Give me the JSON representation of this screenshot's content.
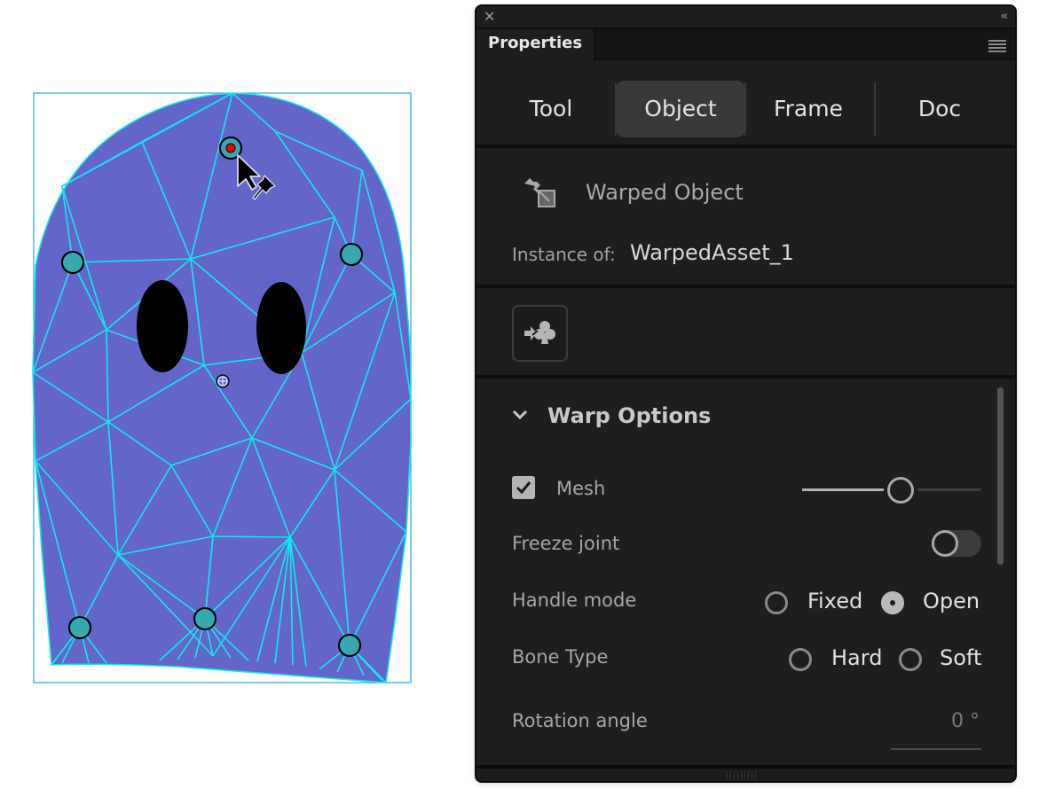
{
  "panel": {
    "close_icon": "close-icon",
    "collapse_icon": "double-chevron-left-icon",
    "collapse_glyph": "‹‹",
    "close_glyph": "✕",
    "tab_label": "Properties",
    "menu_icon": "panel-menu-icon"
  },
  "mode_tabs": [
    {
      "label": "Tool",
      "active": false
    },
    {
      "label": "Object",
      "active": true
    },
    {
      "label": "Frame",
      "active": false
    },
    {
      "label": "Doc",
      "active": false
    }
  ],
  "object": {
    "icon": "warped-object-icon",
    "title": "Warped Object",
    "instance_label": "Instance of:",
    "instance_value": "WarpedAsset_1"
  },
  "swap": {
    "icon": "swap-symbol-icon"
  },
  "warp_options": {
    "title": "Warp Options",
    "expanded": true,
    "mesh": {
      "label": "Mesh",
      "checked": true,
      "slider_value": 0.55
    },
    "freeze_joint": {
      "label": "Freeze joint",
      "on": false
    },
    "handle_mode": {
      "label": "Handle mode",
      "options": [
        {
          "label": "Fixed",
          "selected": false
        },
        {
          "label": "Open",
          "selected": true
        }
      ]
    },
    "bone_type": {
      "label": "Bone Type",
      "options": [
        {
          "label": "Hard",
          "selected": false
        },
        {
          "label": "Soft",
          "selected": false
        }
      ]
    },
    "rotation_angle": {
      "label": "Rotation angle",
      "value": "0 °"
    }
  },
  "canvas": {
    "object_fill": "#6365c9",
    "mesh_color": "#12e8f0",
    "bounding_box_color": "#1eaaf0",
    "handle_color": "#35a8b0",
    "active_handle_color": "#ff0000",
    "eyes_color": "#000000",
    "handles": [
      {
        "name": "handle-top",
        "active": true
      },
      {
        "name": "handle-left"
      },
      {
        "name": "handle-right"
      },
      {
        "name": "handle-bottom-left"
      },
      {
        "name": "handle-bottom-center"
      },
      {
        "name": "handle-bottom-right"
      }
    ]
  }
}
